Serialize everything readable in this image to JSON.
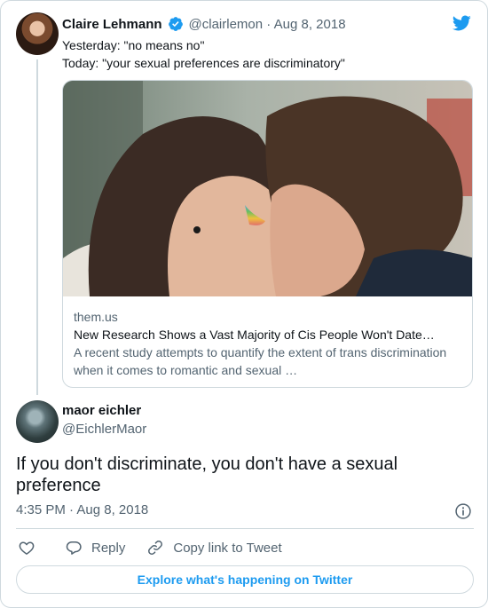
{
  "quoted_tweet": {
    "author_name": "Claire Lehmann",
    "handle": "@clairlemon",
    "date": "Aug 8, 2018",
    "text_lines": [
      "Yesterday: \"no means no\"",
      "Today: \"your sexual preferences are discriminatory\""
    ],
    "link_card": {
      "domain": "them.us",
      "title": "New Research Shows a Vast Majority of Cis People Won't Date…",
      "description": "A recent study attempts to quantify the extent of trans discrimination when it comes to romantic and sexual …"
    }
  },
  "main_tweet": {
    "author_name": "maor eichler",
    "handle": "@EichlerMaor",
    "text": "If you don't discriminate, you don't have a sexual preference",
    "timestamp": "4:35 PM · Aug 8, 2018"
  },
  "actions": {
    "reply_label": "Reply",
    "copy_link_label": "Copy link to Tweet"
  },
  "explore_label": "Explore what's happening on Twitter",
  "icons": {
    "verified": "verified-badge-icon",
    "brand": "twitter-bird-icon",
    "info": "info-icon",
    "like": "heart-icon",
    "reply": "speech-bubble-icon",
    "copy_link": "link-chain-icon"
  },
  "colors": {
    "brand": "#1d9bf0",
    "text_primary": "#0f1419",
    "text_secondary": "#536471",
    "border": "#cfd9de"
  }
}
